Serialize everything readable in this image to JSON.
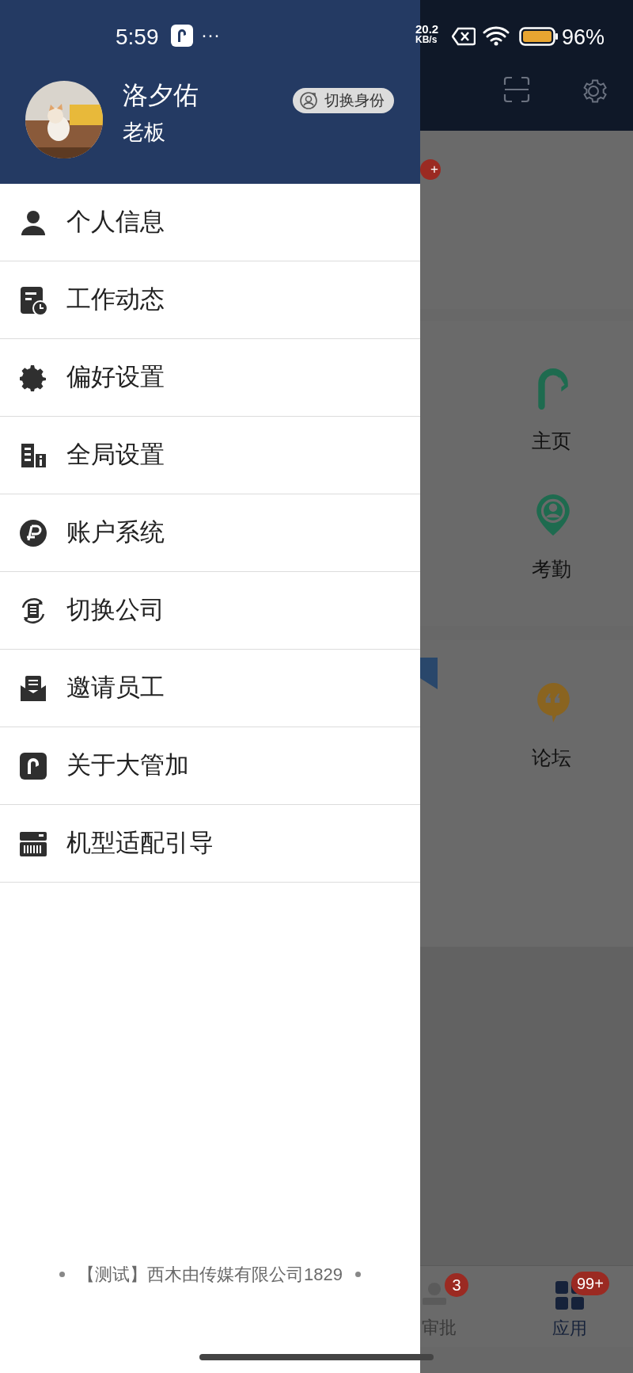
{
  "status_bar": {
    "time": "5:59",
    "more": "···",
    "net_speed": "20.2",
    "net_unit": "KB/s",
    "battery": "96%"
  },
  "drawer": {
    "profile": {
      "name": "洛夕佑",
      "role": "老板",
      "switch_button": "切换身份"
    },
    "menu": [
      {
        "label": "个人信息"
      },
      {
        "label": "工作动态"
      },
      {
        "label": "偏好设置"
      },
      {
        "label": "全局设置"
      },
      {
        "label": "账户系统"
      },
      {
        "label": "切换公司"
      },
      {
        "label": "邀请员工"
      },
      {
        "label": "关于大管加"
      },
      {
        "label": "机型适配引导"
      }
    ],
    "footer": "【测试】西木由传媒有限公司1829"
  },
  "background": {
    "badge": "+",
    "apps": [
      {
        "label": "主页",
        "kind": "home"
      },
      {
        "label": "考勤",
        "kind": "attendance"
      },
      {
        "label": "论坛",
        "kind": "forum"
      }
    ],
    "bottom_nav": [
      {
        "label": "审批",
        "badge": "3"
      },
      {
        "label": "应用",
        "badge": "99+"
      }
    ]
  }
}
